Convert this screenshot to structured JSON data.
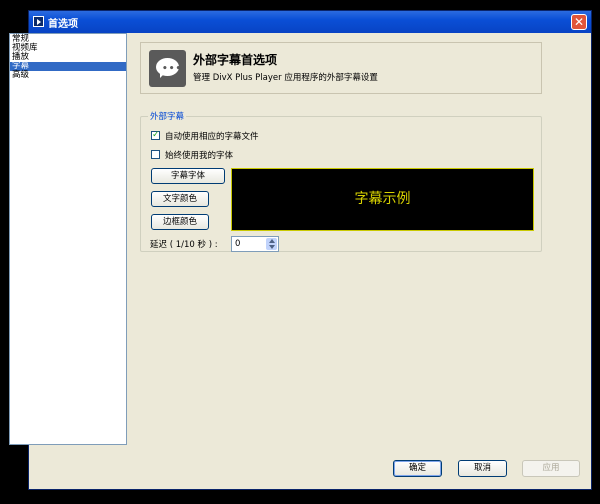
{
  "window": {
    "title": "首选项",
    "close_label": "✕"
  },
  "sidebar": {
    "items": [
      {
        "label": "常规",
        "selected": false
      },
      {
        "label": "视频库",
        "selected": false
      },
      {
        "label": "播放",
        "selected": false
      },
      {
        "label": "字幕",
        "selected": true
      },
      {
        "label": "高级",
        "selected": false
      }
    ]
  },
  "header": {
    "icon": "speech-bubble-icon",
    "title": "外部字幕首选项",
    "description": "管理 DivX Plus Player 应用程序的外部字幕设置"
  },
  "subtitle_group": {
    "label": "外部字幕",
    "auto_use_checkbox": {
      "label": "自动使用相应的字幕文件",
      "checked": true
    },
    "always_font_checkbox": {
      "label": "始终使用我的字体",
      "checked": false
    },
    "font_button": "字幕字体",
    "text_color_button": "文字颜色",
    "border_color_button": "边框颜色",
    "preview_text": "字幕示例",
    "preview_text_color": "#d9d300",
    "preview_border_color": "#c9c900",
    "delay_label": "延迟 ( 1/10 秒 ) :",
    "delay_value": "0"
  },
  "footer": {
    "ok_label": "确定",
    "cancel_label": "取消",
    "apply_label": "应用"
  }
}
